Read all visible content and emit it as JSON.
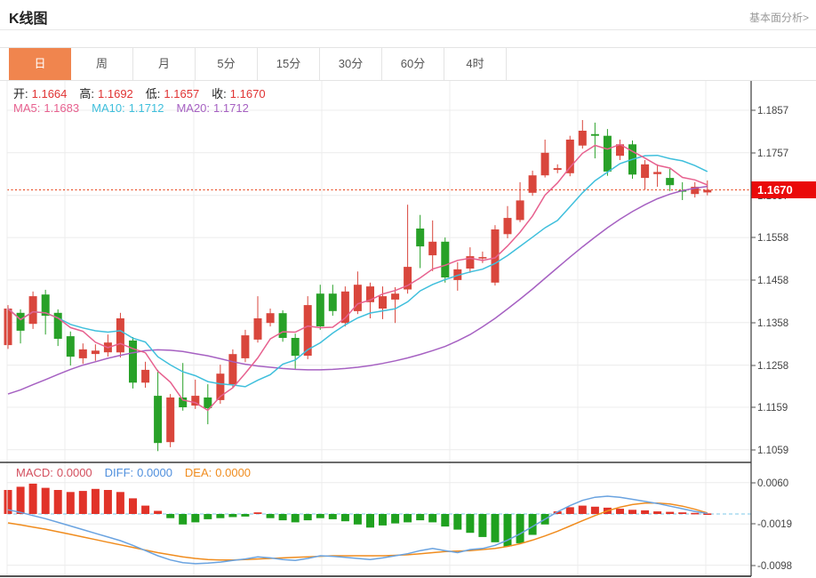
{
  "header": {
    "title": "K线图",
    "link": "基本面分析>"
  },
  "tabs": {
    "items": [
      "日",
      "周",
      "月",
      "5分",
      "15分",
      "30分",
      "60分",
      "4时"
    ],
    "names": [
      "day",
      "week",
      "month",
      "5min",
      "15min",
      "30min",
      "60min",
      "4hour"
    ],
    "selected_index": 0
  },
  "legend": {
    "ohlc": [
      {
        "label": "开:",
        "value": "1.1664"
      },
      {
        "label": "高:",
        "value": "1.1692"
      },
      {
        "label": "低:",
        "value": "1.1657"
      },
      {
        "label": "收:",
        "value": "1.1670"
      }
    ],
    "ma": [
      {
        "label": "MA5:",
        "value": "1.1683",
        "color": "#e7618f"
      },
      {
        "label": "MA10:",
        "value": "1.1712",
        "color": "#3fbfdc"
      },
      {
        "label": "MA20:",
        "value": "1.1712",
        "color": "#a661c2"
      }
    ],
    "macd": [
      {
        "label": "MACD:",
        "value": "0.0000",
        "color": "#d34f5e"
      },
      {
        "label": "DIFF:",
        "value": "0.0000",
        "color": "#4f8fdd"
      },
      {
        "label": "DEA:",
        "value": "0.0000",
        "color": "#f08c1e"
      }
    ]
  },
  "price_tag": "1.1670",
  "colors": {
    "tab_selected_bg": "#f0854e",
    "candle_up": "#d9463c",
    "candle_down": "#28a128",
    "bar_up": "#e13329",
    "bar_down": "#1fa11f",
    "ma5": "#e7618f",
    "ma10": "#3fbfdc",
    "ma20": "#a661c2",
    "diff_line": "#6aa3e0",
    "dea_line": "#f08c1e",
    "dotted_price_line": "#e8502a",
    "price_tag_bg": "#ea0a0a",
    "grid": "#ececec",
    "axis": "#444",
    "ohlc_value": "#e03333",
    "zero_dash": "#7ec8e8"
  },
  "chart_data": {
    "type": "candlestick+macd",
    "title": "K线图",
    "legend_position": "top-left",
    "x_labels_visible": false,
    "price_axis": {
      "ticks": [
        "1.1857",
        "1.1757",
        "1.1657",
        "1.1558",
        "1.1458",
        "1.1358",
        "1.1258",
        "1.1159",
        "1.1059"
      ],
      "tick_values": [
        1.1857,
        1.1757,
        1.1657,
        1.1558,
        1.1458,
        1.1358,
        1.1258,
        1.1159,
        1.1059
      ],
      "last_price": 1.167
    },
    "macd_axis": {
      "ticks": [
        "0.0060",
        "-0.0019",
        "-0.0098"
      ],
      "tick_values": [
        60,
        -19,
        -98
      ],
      "unit": "0.0001"
    },
    "ohlc_last": {
      "open": 1.1664,
      "high": 1.1692,
      "low": 1.1657,
      "close": 1.167
    },
    "ma_last": {
      "ma5": 1.1683,
      "ma10": 1.1712,
      "ma20": 1.1712
    },
    "candles_format": [
      "open",
      "high",
      "low",
      "close"
    ],
    "candles": [
      [
        1.1305,
        1.1399,
        1.1296,
        1.1391
      ],
      [
        1.1381,
        1.1389,
        1.1309,
        1.1339
      ],
      [
        1.1355,
        1.1431,
        1.1343,
        1.142
      ],
      [
        1.1424,
        1.1435,
        1.133,
        1.1374
      ],
      [
        1.1381,
        1.1389,
        1.1303,
        1.132
      ],
      [
        1.1326,
        1.1337,
        1.1257,
        1.1278
      ],
      [
        1.1274,
        1.1309,
        1.1261,
        1.1295
      ],
      [
        1.1284,
        1.1307,
        1.1268,
        1.1292
      ],
      [
        1.1288,
        1.133,
        1.1278,
        1.1311
      ],
      [
        1.1288,
        1.1381,
        1.1276,
        1.1368
      ],
      [
        1.1316,
        1.1324,
        1.1203,
        1.1217
      ],
      [
        1.1217,
        1.1266,
        1.1205,
        1.1247
      ],
      [
        1.1186,
        1.1247,
        1.1056,
        1.1075
      ],
      [
        1.1077,
        1.119,
        1.1065,
        1.1182
      ],
      [
        1.1182,
        1.1263,
        1.1151,
        1.1159
      ],
      [
        1.1163,
        1.1224,
        1.1155,
        1.1186
      ],
      [
        1.1182,
        1.1213,
        1.1119,
        1.1157
      ],
      [
        1.1176,
        1.1259,
        1.1167,
        1.1238
      ],
      [
        1.1213,
        1.1295,
        1.1205,
        1.1284
      ],
      [
        1.1274,
        1.1341,
        1.1265,
        1.1328
      ],
      [
        1.1318,
        1.142,
        1.1311,
        1.1368
      ],
      [
        1.1357,
        1.1391,
        1.1349,
        1.138
      ],
      [
        1.138,
        1.1387,
        1.1313,
        1.1322
      ],
      [
        1.1322,
        1.1332,
        1.1249,
        1.128
      ],
      [
        1.128,
        1.142,
        1.1272,
        1.1399
      ],
      [
        1.1426,
        1.1447,
        1.1341,
        1.1349
      ],
      [
        1.1426,
        1.1447,
        1.1374,
        1.1385
      ],
      [
        1.1357,
        1.1443,
        1.1349,
        1.1431
      ],
      [
        1.1385,
        1.1478,
        1.1378,
        1.1447
      ],
      [
        1.1406,
        1.1452,
        1.1368,
        1.1443
      ],
      [
        1.1391,
        1.1443,
        1.1366,
        1.142
      ],
      [
        1.1412,
        1.1441,
        1.1357,
        1.1426
      ],
      [
        1.1436,
        1.1635,
        1.1426,
        1.1489
      ],
      [
        1.1579,
        1.1611,
        1.1486,
        1.1537
      ],
      [
        1.1516,
        1.1598,
        1.1479,
        1.1548
      ],
      [
        1.1548,
        1.1558,
        1.1452,
        1.1464
      ],
      [
        1.1458,
        1.15,
        1.1433,
        1.1483
      ],
      [
        1.1485,
        1.1535,
        1.1475,
        1.1514
      ],
      [
        1.1509,
        1.1525,
        1.1498,
        1.1512
      ],
      [
        1.1452,
        1.1587,
        1.1445,
        1.1577
      ],
      [
        1.1566,
        1.1632,
        1.1556,
        1.1604
      ],
      [
        1.1599,
        1.1688,
        1.1594,
        1.1645
      ],
      [
        1.1663,
        1.1715,
        1.1656,
        1.1704
      ],
      [
        1.1704,
        1.1788,
        1.1699,
        1.1757
      ],
      [
        1.1717,
        1.173,
        1.1709,
        1.1721
      ],
      [
        1.1709,
        1.1797,
        1.1702,
        1.1788
      ],
      [
        1.1774,
        1.1834,
        1.1767,
        1.1809
      ],
      [
        1.1801,
        1.1828,
        1.1744,
        1.1797
      ],
      [
        1.1797,
        1.1813,
        1.1703,
        1.1713
      ],
      [
        1.175,
        1.1788,
        1.174,
        1.1777
      ],
      [
        1.1777,
        1.1786,
        1.1696,
        1.1706
      ],
      [
        1.1698,
        1.174,
        1.1671,
        1.173
      ],
      [
        1.1707,
        1.173,
        1.1677,
        1.1712
      ],
      [
        1.1698,
        1.1719,
        1.1667,
        1.1681
      ],
      [
        1.1669,
        1.1688,
        1.1646,
        1.1667
      ],
      [
        1.166,
        1.1688,
        1.1652,
        1.1677
      ],
      [
        1.1664,
        1.1692,
        1.1657,
        1.167
      ]
    ],
    "ma20_series": [
      1.119,
      1.12,
      1.1212,
      1.1224,
      1.1236,
      1.1248,
      1.1258,
      1.1266,
      1.1274,
      1.1281,
      1.1287,
      1.1292,
      1.1294,
      1.1293,
      1.129,
      1.1285,
      1.128,
      1.1273,
      1.1266,
      1.126,
      1.1256,
      1.1253,
      1.125,
      1.1248,
      1.1247,
      1.1247,
      1.1248,
      1.125,
      1.1253,
      1.1257,
      1.1262,
      1.1268,
      1.1275,
      1.1283,
      1.1292,
      1.1302,
      1.1315,
      1.133,
      1.1348,
      1.1368,
      1.139,
      1.1413,
      1.1437,
      1.1462,
      1.1487,
      1.1512,
      1.1536,
      1.1559,
      1.1581,
      1.1601,
      1.1619,
      1.1635,
      1.1649,
      1.166,
      1.1668,
      1.1674,
      1.1678
    ],
    "macd": {
      "unit": "0.0001",
      "diff": [
        8,
        3,
        -3,
        -9,
        -16,
        -23,
        -30,
        -37,
        -44,
        -51,
        -60,
        -70,
        -80,
        -88,
        -93,
        -95,
        -94,
        -92,
        -89,
        -86,
        -82,
        -84,
        -87,
        -89,
        -85,
        -80,
        -81,
        -83,
        -85,
        -87,
        -84,
        -80,
        -76,
        -70,
        -66,
        -70,
        -74,
        -68,
        -66,
        -60,
        -50,
        -38,
        -24,
        -10,
        4,
        16,
        26,
        32,
        34,
        32,
        28,
        24,
        20,
        15,
        10,
        5,
        1
      ],
      "dea": [
        -17,
        -21,
        -25,
        -29,
        -34,
        -39,
        -44,
        -49,
        -54,
        -59,
        -64,
        -69,
        -74,
        -78,
        -82,
        -85,
        -87,
        -88,
        -88,
        -87,
        -86,
        -85,
        -84,
        -83,
        -82,
        -81,
        -80,
        -80,
        -80,
        -80,
        -80,
        -79,
        -78,
        -76,
        -74,
        -72,
        -71,
        -70,
        -68,
        -66,
        -62,
        -57,
        -50,
        -42,
        -33,
        -23,
        -13,
        -3,
        6,
        13,
        18,
        21,
        21,
        19,
        15,
        9,
        2
      ],
      "hist": [
        46,
        52,
        58,
        50,
        46,
        42,
        44,
        48,
        46,
        42,
        30,
        16,
        6,
        -8,
        -20,
        -16,
        -10,
        -8,
        -6,
        -5,
        3,
        -8,
        -12,
        -16,
        -12,
        -8,
        -10,
        -14,
        -20,
        -26,
        -22,
        -18,
        -16,
        -12,
        -16,
        -24,
        -30,
        -36,
        -44,
        -54,
        -62,
        -56,
        -40,
        -20,
        5,
        13,
        16,
        14,
        12,
        10,
        8,
        7,
        5,
        4,
        3,
        2,
        1
      ]
    }
  }
}
